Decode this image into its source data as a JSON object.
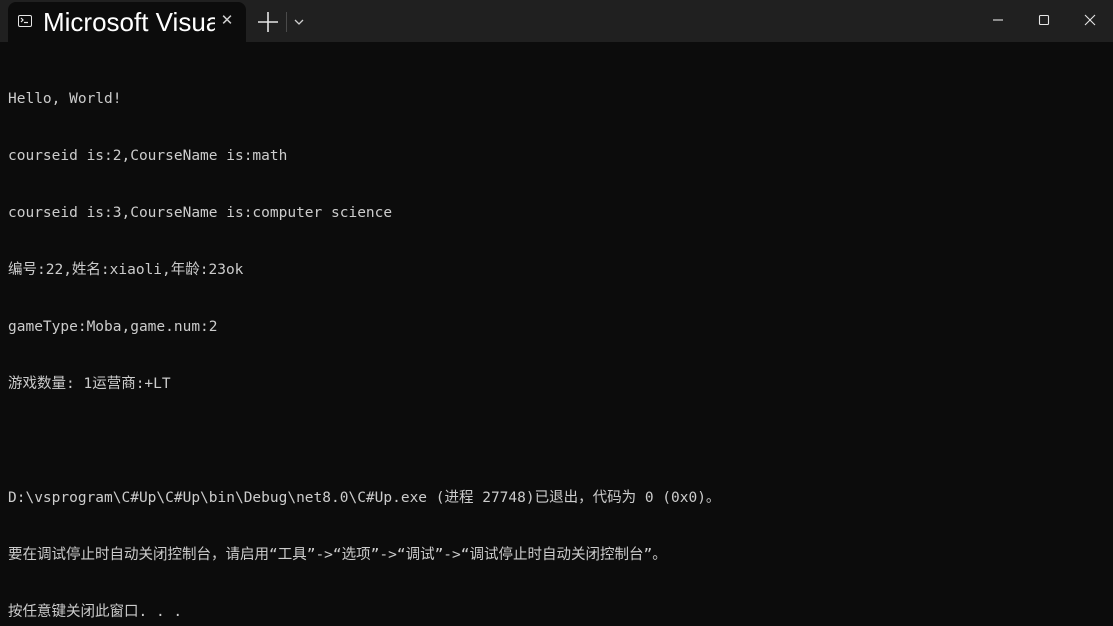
{
  "window": {
    "tab_title": "Microsoft Visual Studio 调试控制台",
    "tab_close_label": "✕"
  },
  "console": {
    "lines": [
      "Hello, World!",
      "courseid is:2,CourseName is:math",
      "courseid is:3,CourseName is:computer science",
      "编号:22,姓名:xiaoli,年龄:23ok",
      "gameType:Moba,game.num:2",
      "游戏数量: 1运营商:+LT",
      "",
      "D:\\vsprogram\\C#Up\\C#Up\\bin\\Debug\\net8.0\\C#Up.exe (进程 27748)已退出，代码为 0 (0x0)。",
      "要在调试停止时自动关闭控制台，请启用“工具”->“选项”->“调试”->“调试停止时自动关闭控制台”。",
      "按任意键关闭此窗口. . ."
    ]
  },
  "colors": {
    "background": "#0c0c0c",
    "titlebar": "#202020",
    "text": "#cccccc"
  },
  "icons": {
    "tab": "console-icon",
    "new_tab": "plus-icon",
    "dropdown": "chevron-down-icon",
    "minimize": "minimize-icon",
    "maximize": "maximize-icon",
    "close": "close-icon"
  }
}
